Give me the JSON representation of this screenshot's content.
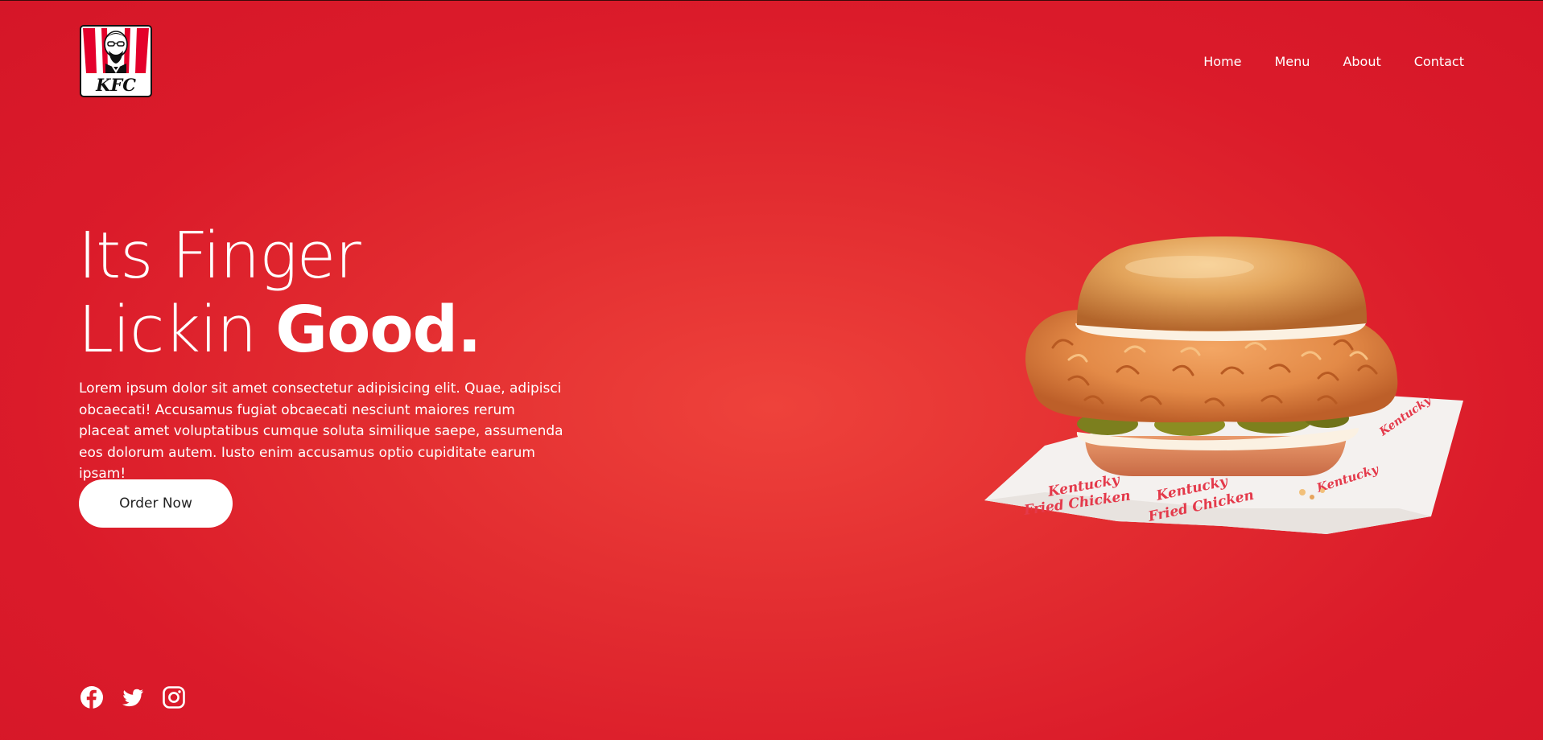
{
  "brand": {
    "logo_text": "KFC",
    "primary_color": "#dd1f2c",
    "accent_color": "#ffffff"
  },
  "nav": {
    "items": [
      {
        "label": "Home"
      },
      {
        "label": "Menu"
      },
      {
        "label": "About"
      },
      {
        "label": "Contact"
      }
    ]
  },
  "hero": {
    "headline_line1": "Its Finger",
    "headline_line2_light": "Lickin ",
    "headline_line2_bold": "Good.",
    "description": "Lorem ipsum dolor sit amet consectetur adipisicing elit. Quae, adipisci obcaecati! Accusamus fugiat obcaecati nesciunt maiores rerum placeat amet voluptatibus cumque soluta similique saepe, assumenda eos dolorum autem. Iusto enim accusamus optio cupiditate earum ipsam!",
    "order_button": "Order Now"
  },
  "product_image": {
    "wrapper_text": "Kentucky Fried Chicken"
  },
  "social": {
    "icons": [
      "facebook-icon",
      "twitter-icon",
      "instagram-icon"
    ]
  }
}
